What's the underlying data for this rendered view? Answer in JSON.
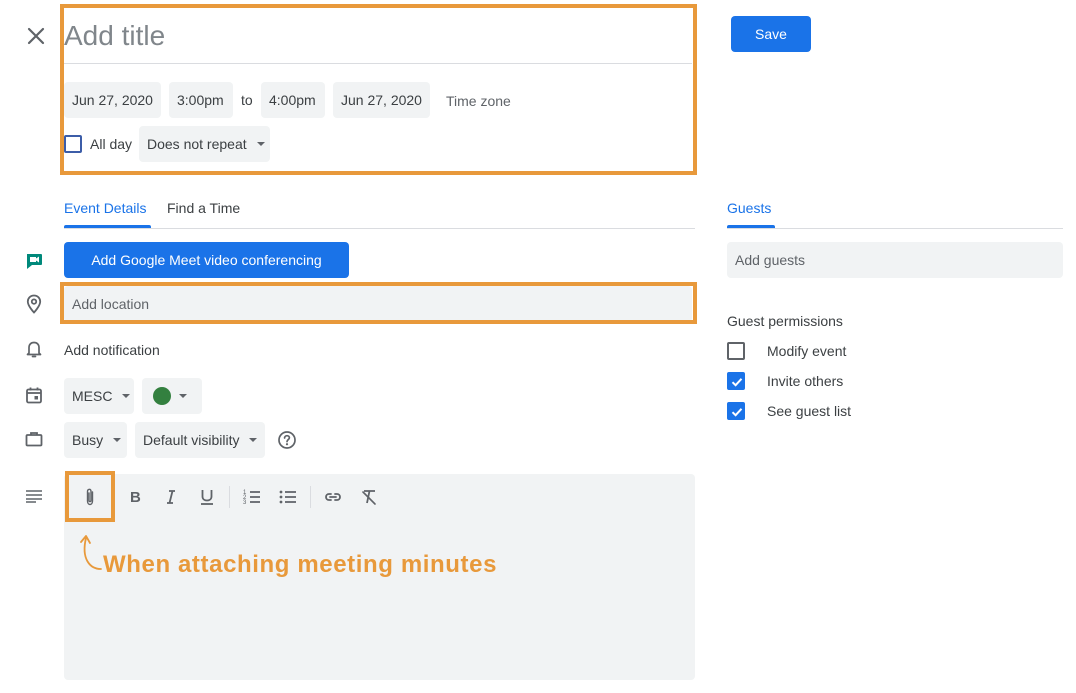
{
  "header": {
    "close_icon": "close-icon",
    "title_placeholder": "Add title",
    "save_label": "Save"
  },
  "datetime": {
    "start_date": "Jun 27, 2020",
    "start_time": "3:00pm",
    "to_label": "to",
    "end_time": "4:00pm",
    "end_date": "Jun 27, 2020",
    "timezone_label": "Time zone",
    "all_day_label": "All day",
    "all_day_checked": false,
    "repeat_value": "Does not repeat"
  },
  "tabs": [
    {
      "label": "Event Details",
      "active": true
    },
    {
      "label": "Find a Time",
      "active": false
    }
  ],
  "details": {
    "meet_button_label": "Add Google Meet video conferencing",
    "location_placeholder": "Add location",
    "notification_label": "Add notification",
    "calendar_value": "MESC",
    "event_color": "#33803f",
    "busy_value": "Busy",
    "visibility_value": "Default visibility",
    "help_icon": "help-circle-icon"
  },
  "toolbar": {
    "icons": [
      "attachment-icon",
      "bold-icon",
      "italic-icon",
      "underline-icon",
      "numbered-list-icon",
      "bulleted-list-icon",
      "link-icon",
      "clear-formatting-icon"
    ]
  },
  "annotation": {
    "text": "When attaching meeting minutes",
    "color": "#e8993b"
  },
  "guests": {
    "tab_label": "Guests",
    "input_placeholder": "Add guests",
    "permissions_title": "Guest permissions",
    "permissions": [
      {
        "label": "Modify event",
        "checked": false
      },
      {
        "label": "Invite others",
        "checked": true
      },
      {
        "label": "See guest list",
        "checked": true
      }
    ]
  },
  "colors": {
    "accent": "#1a73e8",
    "field_bg": "#f1f3f4",
    "highlight": "#e8993b",
    "meet_green": "#00897b"
  }
}
